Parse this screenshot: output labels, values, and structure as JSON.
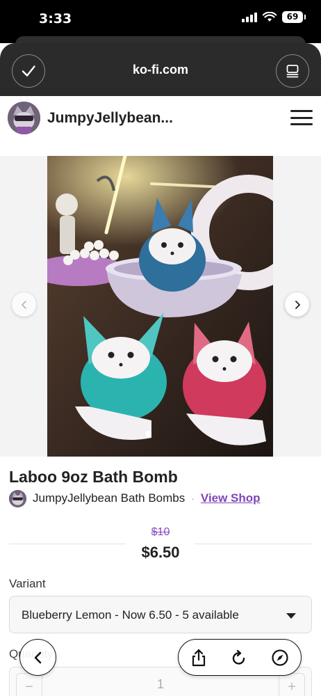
{
  "status_bar": {
    "time": "3:33",
    "battery": "69"
  },
  "browser": {
    "url": "ko-fi.com"
  },
  "header": {
    "shop_name": "JumpyJellybean..."
  },
  "product": {
    "title": "Laboo 9oz Bath Bomb",
    "seller": "JumpyJellybean Bath Bombs",
    "separator": "·",
    "view_shop": "View Shop",
    "old_price": "$10",
    "price": "$6.50"
  },
  "variant": {
    "label": "Variant",
    "selected": "Blueberry Lemon - Now 6.50 - 5 available"
  },
  "quantity": {
    "label": "Quantity",
    "value": "1",
    "minus": "−",
    "plus": "+"
  },
  "icons": {
    "done": "checkmark-icon",
    "tabs": "tab-overview-icon",
    "menu": "hamburger-menu-icon",
    "prev": "chevron-left-icon",
    "next": "chevron-right-icon",
    "back": "chevron-left-icon",
    "share": "share-icon",
    "reload": "reload-icon",
    "compass": "compass-icon"
  },
  "colors": {
    "accent": "#7f44b8",
    "chrome": "#2b2b2b"
  }
}
